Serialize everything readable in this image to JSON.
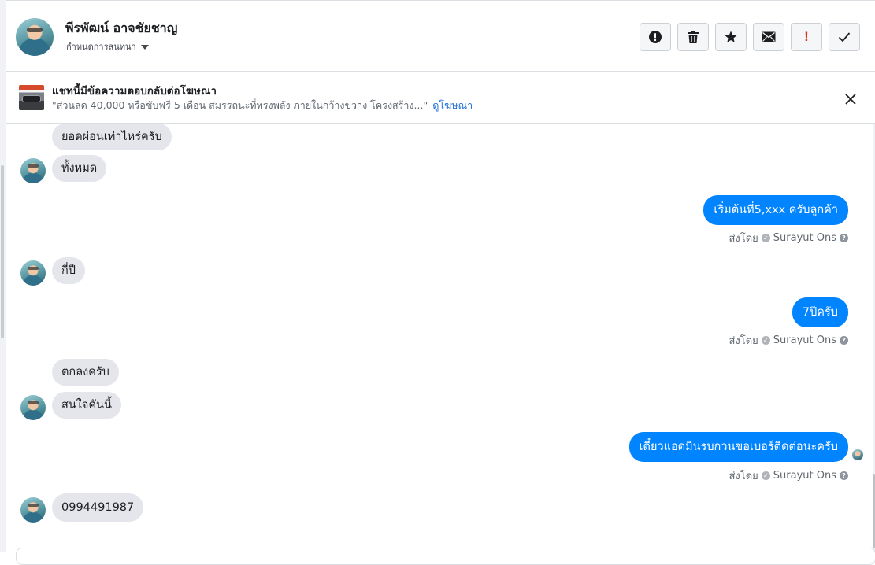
{
  "header": {
    "contact_name": "พีรพัฒน์ อาจชัยชาญ",
    "status_label": "กำหนดการสนทนา",
    "actions": [
      {
        "name": "report-button",
        "icon": "alert-circle-icon"
      },
      {
        "name": "delete-button",
        "icon": "trash-icon"
      },
      {
        "name": "star-button",
        "icon": "star-icon"
      },
      {
        "name": "mark-unread-button",
        "icon": "envelope-icon"
      },
      {
        "name": "spam-button",
        "icon": "exclamation-icon",
        "label": "!"
      },
      {
        "name": "done-button",
        "icon": "checkmark-icon"
      }
    ]
  },
  "ad_banner": {
    "title": "แชทนี้มีข้อความตอบกลับต่อโฆษณา",
    "body": "\"ส่วนลด 40,000 หรือชับฟรี 5 เดือน สมรรถนะที่ทรงพลัง ภายในกว้างขวาง โครงสร้าง...\"",
    "link": "ดูโฆษณา"
  },
  "messages": [
    {
      "direction": "in",
      "text": "ยอดผ่อนเท่าไหร่ครับ"
    },
    {
      "direction": "in",
      "text": "ทั้งหมด"
    },
    {
      "direction": "out",
      "text": "เริ่มต้นที่5,xxx ครับลูกค้า"
    },
    {
      "direction": "in",
      "text": "กี่ปี"
    },
    {
      "direction": "out",
      "text": "7ปีครับ"
    },
    {
      "direction": "in",
      "text": "ตกลงครับ"
    },
    {
      "direction": "in",
      "text": "สนใจคันนี้"
    },
    {
      "direction": "out",
      "text": "เดี๋ยวแอดมินรบกวนขอเบอร์ติดต่อนะครับ"
    },
    {
      "direction": "in",
      "text": "0994491987"
    }
  ],
  "sent_by": {
    "prefix": "ส่งโดย",
    "agent": "Surayut Ons"
  },
  "colors": {
    "outgoing_bubble": "#0084ff",
    "incoming_bubble": "#e4e6eb",
    "link": "#216fdb",
    "spam_icon": "#e02c20"
  }
}
